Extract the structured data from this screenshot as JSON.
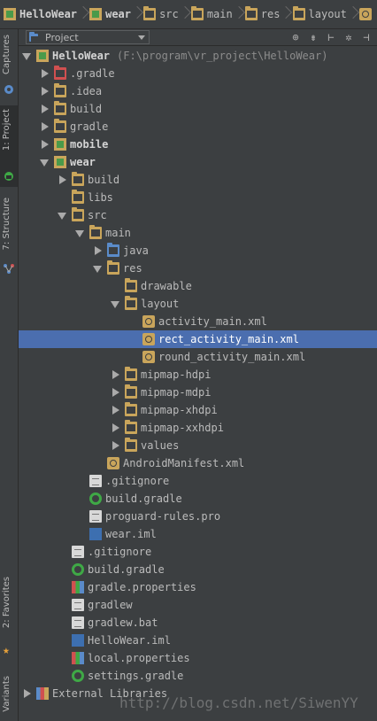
{
  "breadcrumb": [
    "HelloWear",
    "wear",
    "src",
    "main",
    "res",
    "layout"
  ],
  "left_strip": {
    "captures": "Captures",
    "project": "1: Project",
    "structure": "7: Structure",
    "favorites": "2: Favorites",
    "variants": "Variants"
  },
  "panel": {
    "view_selector": "Project"
  },
  "tree": [
    {
      "label": "HelloWear",
      "path": "(F:\\program\\vr_project\\HelloWear)",
      "arrow": "down",
      "icon": "module",
      "bold": true
    },
    {
      "label": ".gradle",
      "arrow": "right",
      "icon": "folder-red"
    },
    {
      "label": ".idea",
      "arrow": "right",
      "icon": "folder"
    },
    {
      "label": "build",
      "arrow": "right",
      "icon": "folder"
    },
    {
      "label": "gradle",
      "arrow": "right",
      "icon": "folder"
    },
    {
      "label": "mobile",
      "arrow": "right",
      "icon": "module",
      "bold": true
    },
    {
      "label": "wear",
      "arrow": "down",
      "icon": "module",
      "bold": true
    },
    {
      "label": "build",
      "arrow": "right",
      "icon": "folder"
    },
    {
      "label": "libs",
      "arrow": "none",
      "icon": "folder"
    },
    {
      "label": "src",
      "arrow": "down",
      "icon": "folder"
    },
    {
      "label": "main",
      "arrow": "down",
      "icon": "folder"
    },
    {
      "label": "java",
      "arrow": "right",
      "icon": "folder-blue"
    },
    {
      "label": "res",
      "arrow": "down",
      "icon": "folder"
    },
    {
      "label": "drawable",
      "arrow": "none",
      "icon": "folder"
    },
    {
      "label": "layout",
      "arrow": "down",
      "icon": "folder"
    },
    {
      "label": "activity_main.xml",
      "arrow": "none",
      "icon": "xml"
    },
    {
      "label": "rect_activity_main.xml",
      "arrow": "none",
      "icon": "xml",
      "selected": true
    },
    {
      "label": "round_activity_main.xml",
      "arrow": "none",
      "icon": "xml"
    },
    {
      "label": "mipmap-hdpi",
      "arrow": "right",
      "icon": "folder"
    },
    {
      "label": "mipmap-mdpi",
      "arrow": "right",
      "icon": "folder"
    },
    {
      "label": "mipmap-xhdpi",
      "arrow": "right",
      "icon": "folder"
    },
    {
      "label": "mipmap-xxhdpi",
      "arrow": "right",
      "icon": "folder"
    },
    {
      "label": "values",
      "arrow": "right",
      "icon": "folder"
    },
    {
      "label": "AndroidManifest.xml",
      "arrow": "none",
      "icon": "xml"
    },
    {
      "label": ".gitignore",
      "arrow": "none",
      "icon": "doc"
    },
    {
      "label": "build.gradle",
      "arrow": "none",
      "icon": "gradle"
    },
    {
      "label": "proguard-rules.pro",
      "arrow": "none",
      "icon": "doc"
    },
    {
      "label": "wear.iml",
      "arrow": "none",
      "icon": "iml"
    },
    {
      "label": ".gitignore",
      "arrow": "none",
      "icon": "doc"
    },
    {
      "label": "build.gradle",
      "arrow": "none",
      "icon": "gradle"
    },
    {
      "label": "gradle.properties",
      "arrow": "none",
      "icon": "props"
    },
    {
      "label": "gradlew",
      "arrow": "none",
      "icon": "doc"
    },
    {
      "label": "gradlew.bat",
      "arrow": "none",
      "icon": "doc"
    },
    {
      "label": "HelloWear.iml",
      "arrow": "none",
      "icon": "iml"
    },
    {
      "label": "local.properties",
      "arrow": "none",
      "icon": "props"
    },
    {
      "label": "settings.gradle",
      "arrow": "none",
      "icon": "gradle"
    },
    {
      "label": "External Libraries",
      "arrow": "right",
      "icon": "libs"
    }
  ],
  "watermark": "http://blog.csdn.net/SiwenYY"
}
